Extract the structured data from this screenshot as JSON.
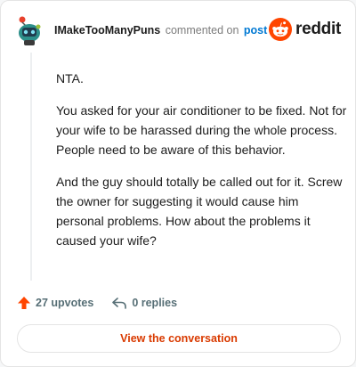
{
  "header": {
    "username": "IMakeTooManyPuns",
    "commented_on": "commented on",
    "post_link": "post",
    "brand": "reddit"
  },
  "comment": {
    "paragraphs": [
      "NTA.",
      "You asked for your air conditioner to be fixed. Not for your wife to be harassed during the whole process. People need to be aware of this behavior.",
      "And the guy should totally be called out for it. Screw the owner for suggesting it would cause him personal problems. How about the problems it caused your wife?"
    ]
  },
  "actions": {
    "upvotes": "27 upvotes",
    "replies": "0 replies"
  },
  "cta": {
    "label": "View the conversation"
  },
  "colors": {
    "brand_orange": "#ff4500",
    "link_blue": "#0079d3",
    "cta_text": "#d93a00",
    "upvote": "#ff4500"
  },
  "icons": [
    "avatar-snoo",
    "reddit-logo-icon",
    "upvote-arrow-icon",
    "reply-icon"
  ]
}
